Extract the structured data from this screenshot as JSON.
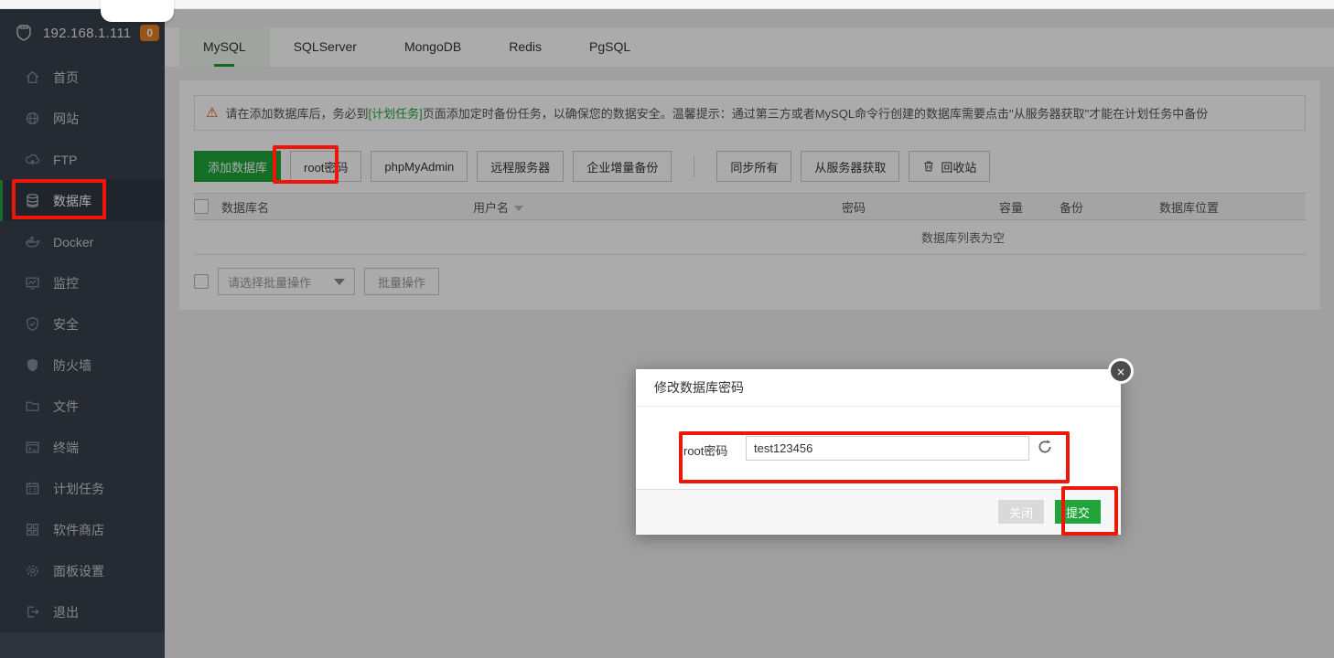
{
  "sidebar": {
    "server_ip": "192.168.1.111",
    "badge": "0",
    "items": [
      {
        "label": "首页"
      },
      {
        "label": "网站"
      },
      {
        "label": "FTP"
      },
      {
        "label": "数据库"
      },
      {
        "label": "Docker"
      },
      {
        "label": "监控"
      },
      {
        "label": "安全"
      },
      {
        "label": "防火墙"
      },
      {
        "label": "文件"
      },
      {
        "label": "终端"
      },
      {
        "label": "计划任务"
      },
      {
        "label": "软件商店"
      },
      {
        "label": "面板设置"
      },
      {
        "label": "退出"
      }
    ]
  },
  "tabs": [
    {
      "label": "MySQL",
      "active": true
    },
    {
      "label": "SQLServer",
      "active": false
    },
    {
      "label": "MongoDB",
      "active": false
    },
    {
      "label": "Redis",
      "active": false
    },
    {
      "label": "PgSQL",
      "active": false
    }
  ],
  "notice": {
    "text_before": "请在添加数据库后，务必到",
    "link": "[计划任务]",
    "text_after": "页面添加定时备份任务，以确保您的数据安全。温馨提示：通过第三方或者MySQL命令行创建的数据库需要点击\"从服务器获取\"才能在计划任务中备份"
  },
  "toolbar": {
    "add_db": "添加数据库",
    "root_pwd": "root密码",
    "phpmyadmin": "phpMyAdmin",
    "remote_server": "远程服务器",
    "enterprise_backup": "企业增量备份",
    "sync_all": "同步所有",
    "fetch_from_server": "从服务器获取",
    "recycle_bin": "回收站"
  },
  "table": {
    "headers": [
      "数据库名",
      "用户名",
      "密码",
      "容量",
      "备份",
      "数据库位置"
    ],
    "empty_text": "数据库列表为空"
  },
  "batch": {
    "select_placeholder": "请选择批量操作",
    "apply_label": "批量操作"
  },
  "modal": {
    "title": "修改数据库密码",
    "field_label": "root密码",
    "field_value": "test123456",
    "close_label": "关闭",
    "submit_label": "提交",
    "close_x": "×"
  },
  "colors": {
    "accent_green": "#20a53a",
    "annotation_red": "#ee1509",
    "badge_orange": "#e67e22",
    "sidebar_bg": "#3a414d"
  }
}
